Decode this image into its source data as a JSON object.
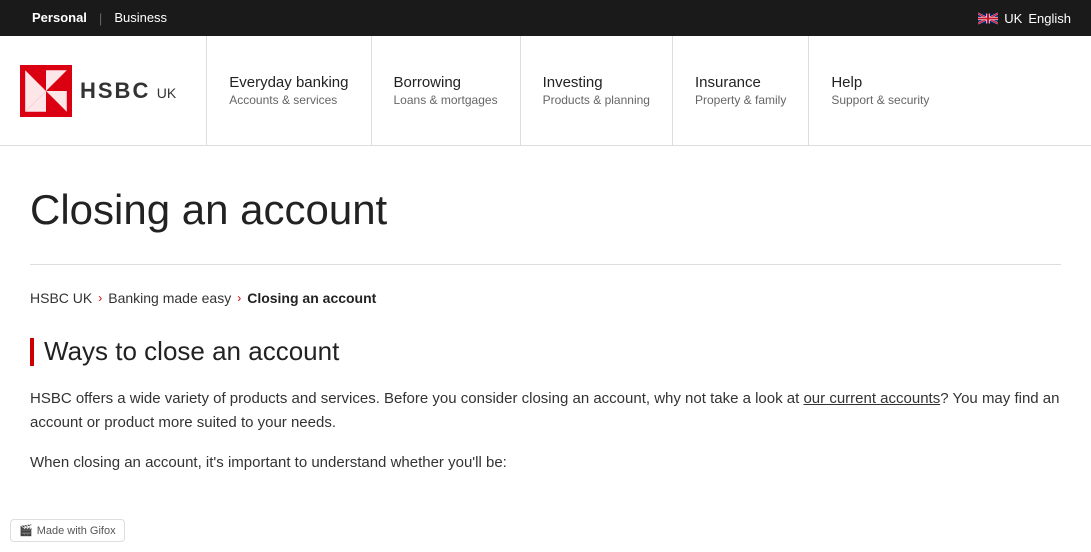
{
  "topBar": {
    "personal_label": "Personal",
    "business_label": "Business",
    "locale_flag": "🇬🇧",
    "locale_uk": "UK",
    "locale_lang": "English"
  },
  "nav": {
    "logo_text": "HSBC",
    "logo_suffix": "UK",
    "items": [
      {
        "title": "Everyday banking",
        "subtitle": "Accounts & services"
      },
      {
        "title": "Borrowing",
        "subtitle": "Loans & mortgages"
      },
      {
        "title": "Investing",
        "subtitle": "Products & planning"
      },
      {
        "title": "Insurance",
        "subtitle": "Property & family"
      },
      {
        "title": "Help",
        "subtitle": "Support & security"
      }
    ]
  },
  "page": {
    "title": "Closing an account",
    "breadcrumb": {
      "home": "HSBC UK",
      "section": "Banking made easy",
      "current": "Closing an account"
    },
    "section_title": "Ways to close an account",
    "body1": "HSBC offers a wide variety of products and services. Before you consider closing an account, why not take a look at our current accounts? You may find an account or product more suited to your needs.",
    "link_text": "our current accounts",
    "body2": "When closing an account, it's important to understand whether you'll be:"
  },
  "gifox": {
    "label": "Made with Gifox"
  }
}
